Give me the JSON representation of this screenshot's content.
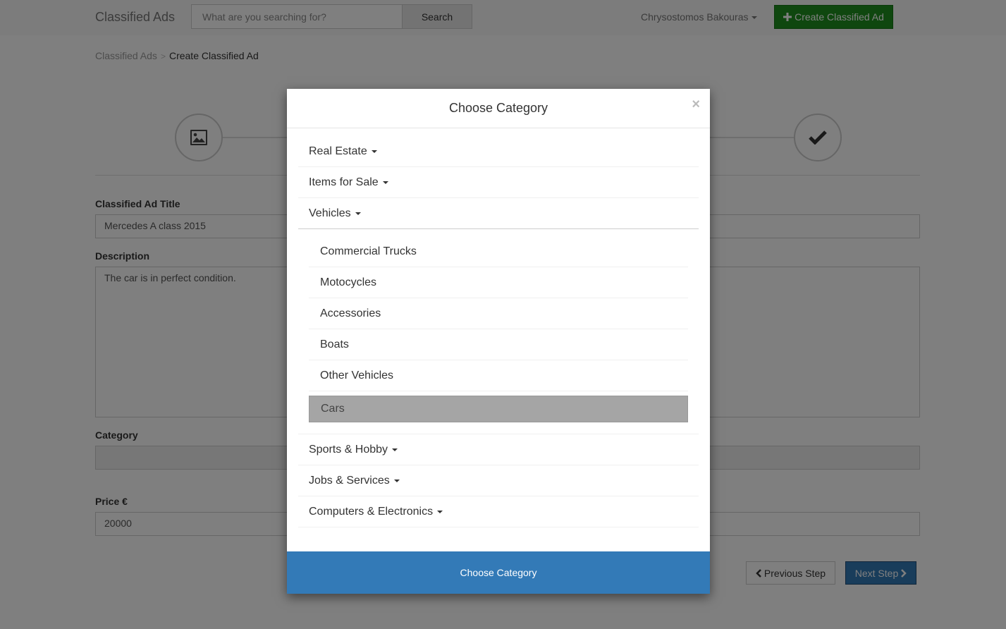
{
  "navbar": {
    "brand": "Classified Ads",
    "search_placeholder": "What are you searching for?",
    "search_button": "Search",
    "user_name": "Chrysostomos Bakouras",
    "create_button": "Create Classified Ad"
  },
  "breadcrumb": {
    "root": "Classified Ads",
    "separator": ">",
    "current": "Create Classified Ad"
  },
  "steps": {
    "first_icon": "image-icon",
    "last_icon": "checkmark-icon"
  },
  "form": {
    "title_label": "Classified Ad Title",
    "title_value": "Mercedes A class 2015",
    "description_label": "Description",
    "description_value": "The car is in perfect condition.",
    "category_label": "Category",
    "category_value": "",
    "price_label": "Price €",
    "price_value": "20000"
  },
  "nav_buttons": {
    "previous": "Previous Step",
    "next": "Next Step"
  },
  "modal": {
    "title": "Choose Category",
    "close": "×",
    "categories_before": [
      {
        "label": "Real Estate"
      },
      {
        "label": "Items for Sale"
      }
    ],
    "open_category": "Vehicles",
    "subcategories": [
      {
        "label": "Commercial Trucks"
      },
      {
        "label": "Motocycles"
      },
      {
        "label": "Accessories"
      },
      {
        "label": "Boats"
      },
      {
        "label": "Other Vehicles"
      }
    ],
    "selected_subcategory": "Cars",
    "categories_after": [
      {
        "label": "Sports & Hobby"
      },
      {
        "label": "Jobs & Services"
      },
      {
        "label": "Computers & Electronics"
      }
    ],
    "footer_button": "Choose Category"
  },
  "colors": {
    "primary": "#337ab7",
    "success": "#1f8e1f",
    "selected_bg": "#a5a5a5"
  }
}
